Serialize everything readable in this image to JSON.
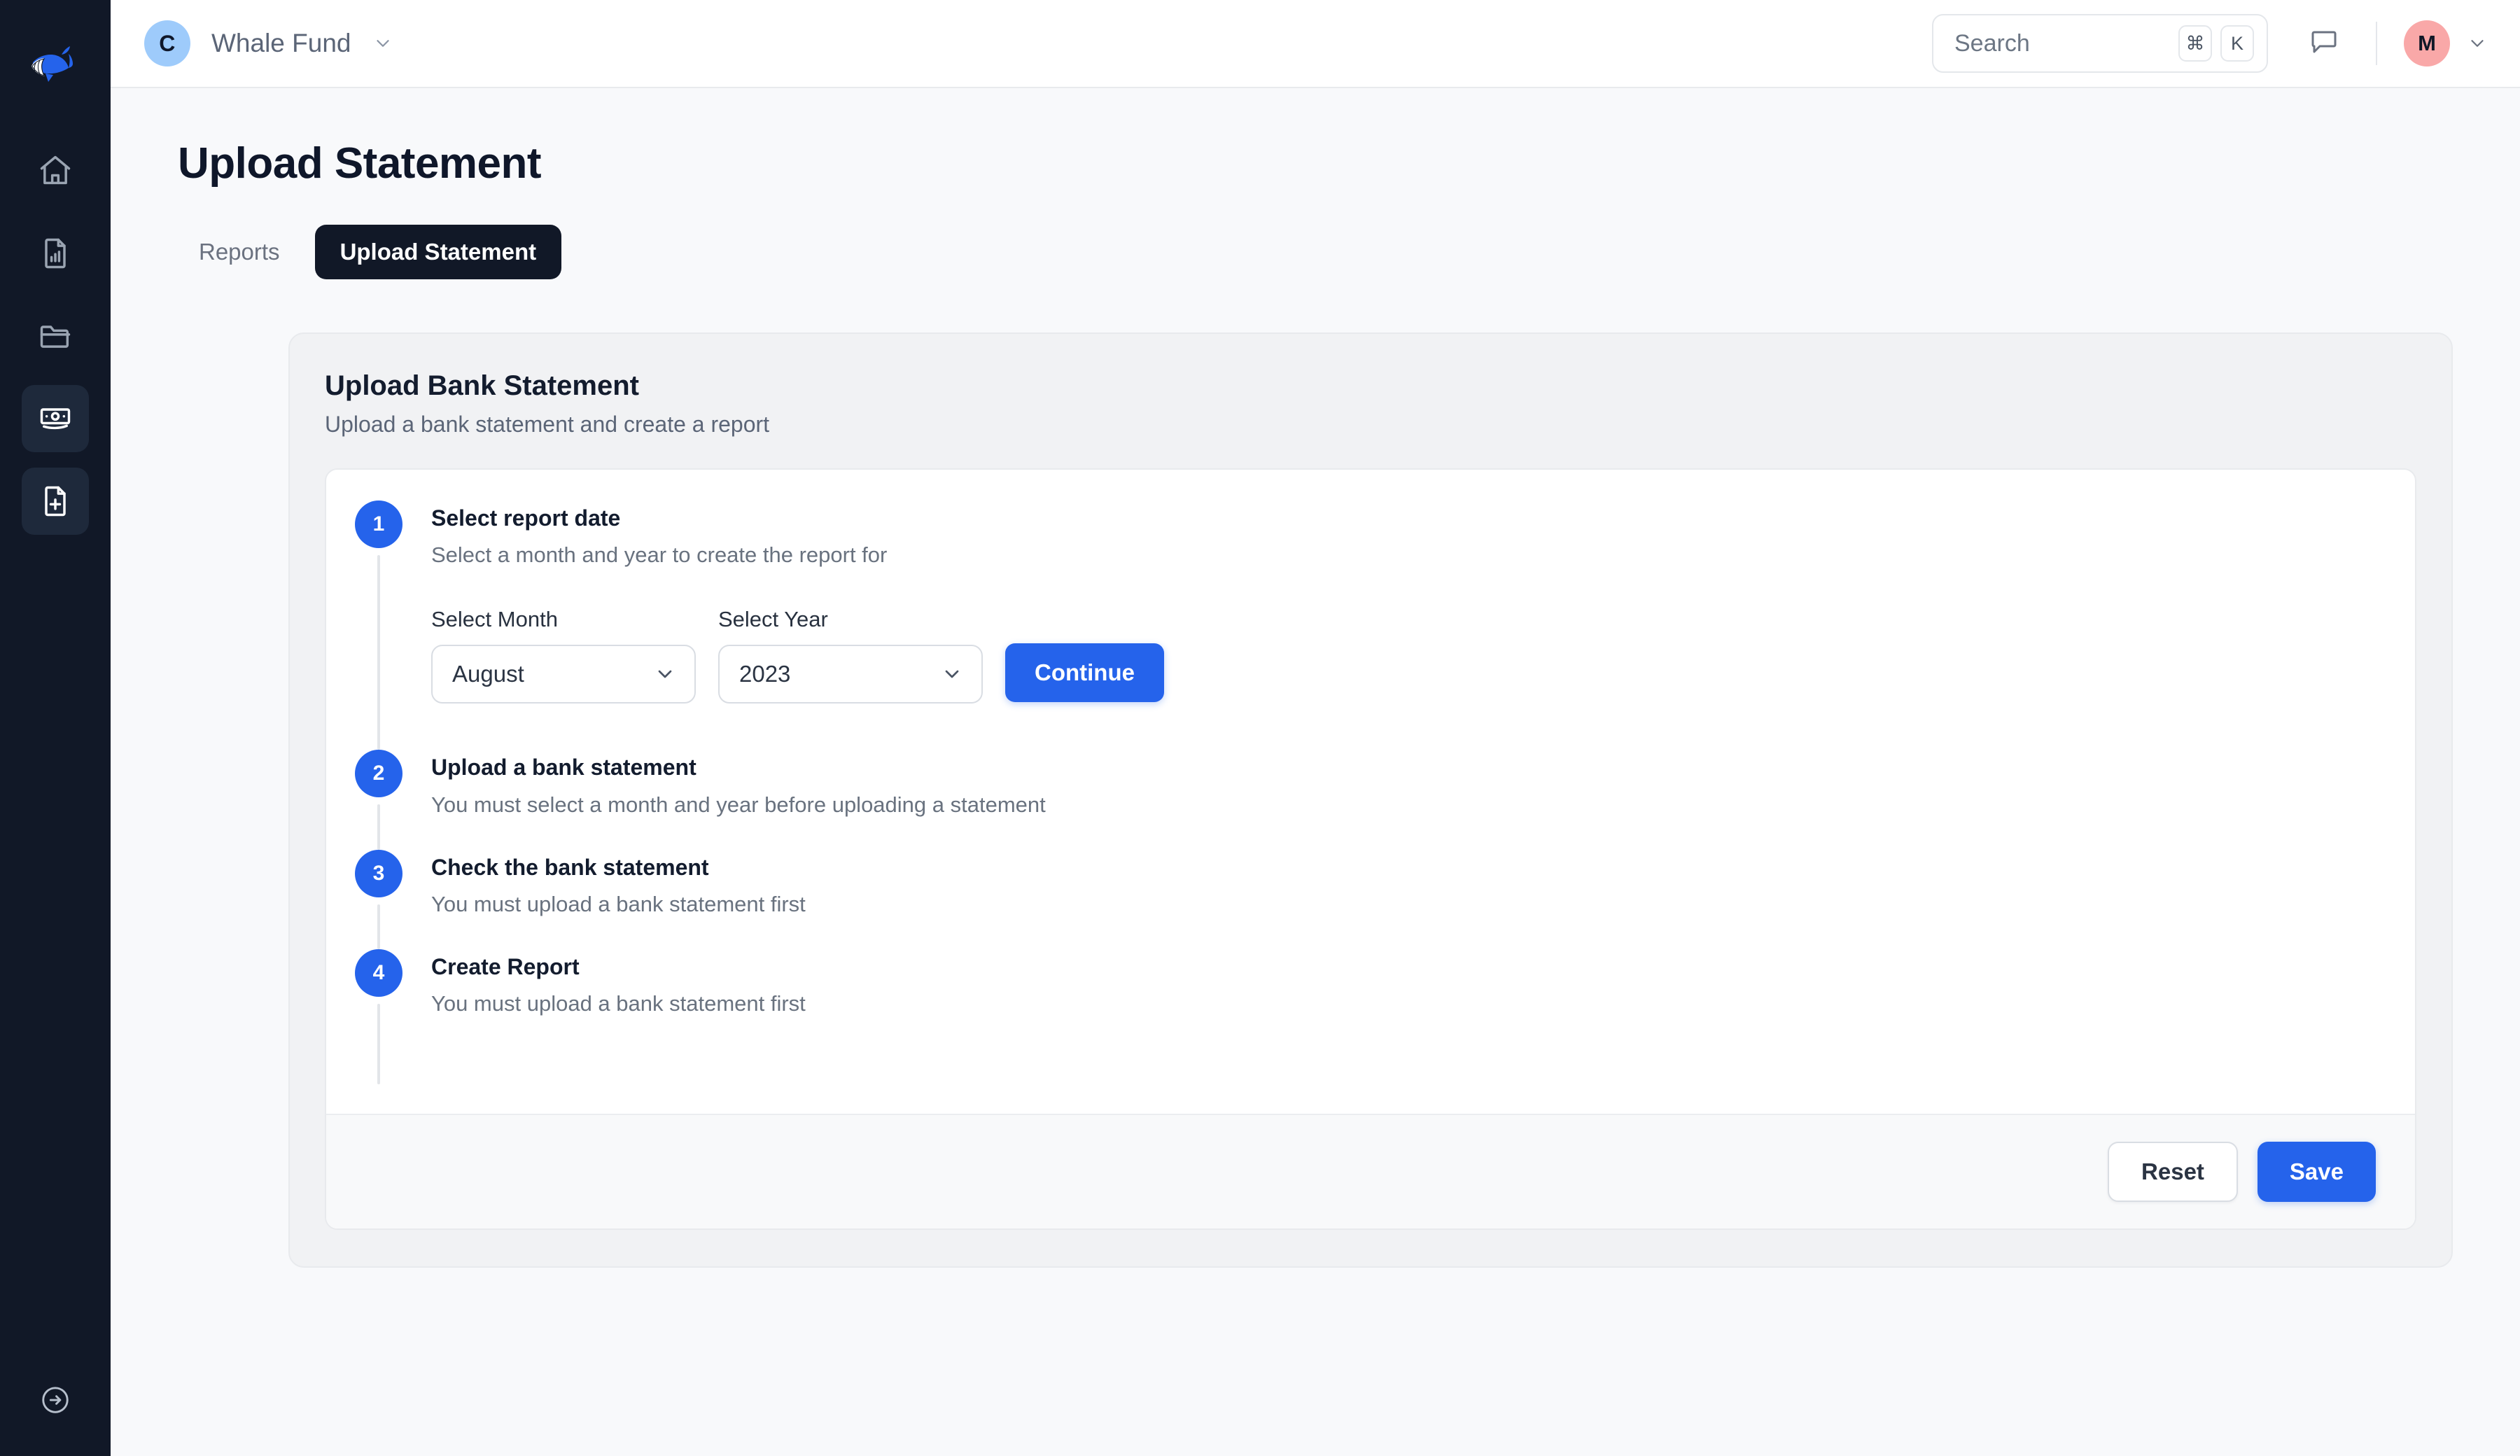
{
  "brand": {
    "logo_icon": "whale-logo-icon",
    "accent_color": "#2563eb",
    "sidebar_color": "#111827"
  },
  "sidebar": {
    "items": [
      {
        "icon": "home-icon",
        "name": "home",
        "active": false
      },
      {
        "icon": "document-chart-icon",
        "name": "reports",
        "active": false
      },
      {
        "icon": "folder-icon",
        "name": "folders",
        "active": false
      },
      {
        "icon": "banknotes-icon",
        "name": "transactions",
        "active": true
      },
      {
        "icon": "document-plus-icon",
        "name": "upload-statement",
        "active": true
      }
    ],
    "collapse_icon": "arrow-right-circle-icon"
  },
  "header": {
    "workspace": {
      "avatar_initial": "C",
      "avatar_color": "#9ecbfb",
      "name": "Whale Fund",
      "chevron_icon": "chevron-down-icon"
    },
    "search": {
      "placeholder": "Search",
      "shortcut_modifier": "⌘",
      "shortcut_key": "K",
      "icon": "search-icon"
    },
    "chat_icon": "chat-bubble-icon",
    "user": {
      "avatar_initial": "M",
      "avatar_color": "#f9a8a8",
      "chevron_icon": "chevron-down-icon"
    }
  },
  "page": {
    "title": "Upload Statement",
    "tabs": [
      {
        "label": "Reports",
        "active": false
      },
      {
        "label": "Upload Statement",
        "active": true
      }
    ]
  },
  "card": {
    "title": "Upload Bank Statement",
    "subtitle": "Upload a bank statement and create a report",
    "steps": [
      {
        "number": "1",
        "title": "Select report date",
        "description": "Select a month and year to create the report for"
      },
      {
        "number": "2",
        "title": "Upload a bank statement",
        "description": "You must select a month and year before uploading a statement"
      },
      {
        "number": "3",
        "title": "Check the bank statement",
        "description": "You must upload a bank statement first"
      },
      {
        "number": "4",
        "title": "Create Report",
        "description": "You must upload a bank statement first"
      }
    ],
    "form": {
      "month_label": "Select Month",
      "month_value": "August",
      "year_label": "Select Year",
      "year_value": "2023",
      "continue_label": "Continue",
      "chevron_icon": "chevron-down-icon"
    },
    "footer": {
      "reset_label": "Reset",
      "save_label": "Save"
    }
  }
}
